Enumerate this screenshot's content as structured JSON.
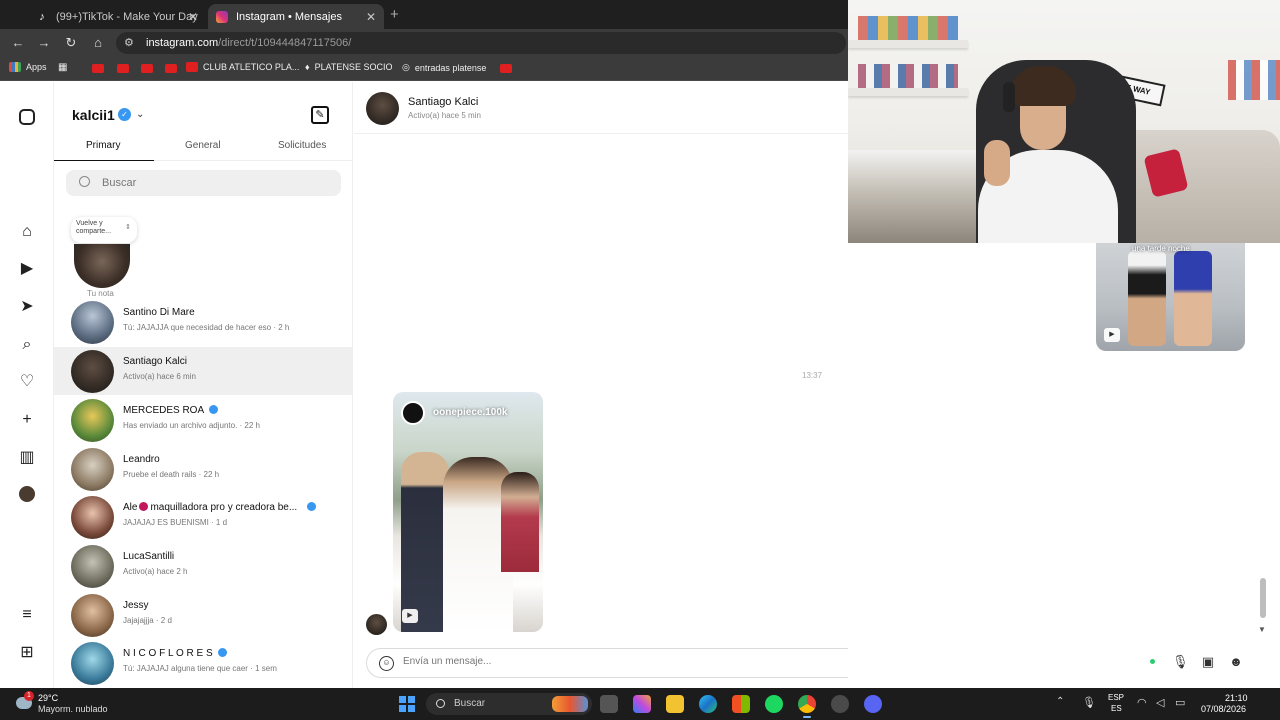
{
  "browser": {
    "tabs": [
      {
        "title": "(99+)TikTok - Make Your Day",
        "icon": "tiktok-icon"
      },
      {
        "title": "Instagram • Mensajes",
        "icon": "instagram-icon"
      }
    ],
    "url_host": "instagram.com",
    "url_path": "/direct/t/109444847117506/",
    "bookmarks": {
      "apps": "Apps",
      "club": "CLUB ATLETICO PLA...",
      "socio": "PLATENSE SOCIO",
      "entradas": "entradas platense"
    }
  },
  "inbox": {
    "username": "kalcii1",
    "tabs": [
      "Primary",
      "General",
      "Solicitudes"
    ],
    "search_placeholder": "Buscar",
    "note_bubble": "Vuelve y comparte...",
    "note_label": "Tu nota",
    "conversations": [
      {
        "name": "Santino Di Mare",
        "preview": "Tú: JAJAJJA que necesidad de hacer eso · 2 h",
        "verified": false
      },
      {
        "name": "Santiago Kalci",
        "preview": "Activo(a) hace 6 min",
        "verified": false,
        "active": true
      },
      {
        "name": "MERCEDES ROA",
        "preview": "Has enviado un archivo adjunto. · 22 h",
        "verified": true
      },
      {
        "name": "Leandro",
        "preview": "Pruebe el death rails · 22 h",
        "verified": false
      },
      {
        "name_pre": "Ale",
        "name_post": "maquilladora pro y creadora be...",
        "preview": "JAJAJAJ ES BUENISMI · 1 d",
        "verified": true
      },
      {
        "name": "LucaSantilli",
        "preview": "Activo(a) hace 2 h",
        "verified": false
      },
      {
        "name": "Jessy",
        "preview": "Jajajajjja · 2 d",
        "verified": false
      },
      {
        "name": "N I C O F L O R E S",
        "preview": "Tú: JAJAJAJ alguna tiene que caer · 1 sem",
        "verified": true
      }
    ]
  },
  "chat": {
    "name": "Santiago Kalci",
    "status": "Activo(a) hace 5 min",
    "timestamp": "13:37",
    "reel_user": "oonepiece.100k",
    "reel_right_caption": "una tarde noche",
    "composer_placeholder": "Envía un mensaje...",
    "sign_text": "ONE WAY"
  },
  "taskbar": {
    "weather_temp": "29°C",
    "weather_desc": "Mayorm. nublado",
    "weather_badge": "1",
    "search": "Buscar",
    "lang1": "ESP",
    "lang2": "ES",
    "time": "21:10",
    "date": "07/08/2026"
  },
  "colors": {
    "accent": "#3897f0",
    "chrome_dark": "#1f1f1f",
    "taskbar": "#1c1c1c"
  }
}
